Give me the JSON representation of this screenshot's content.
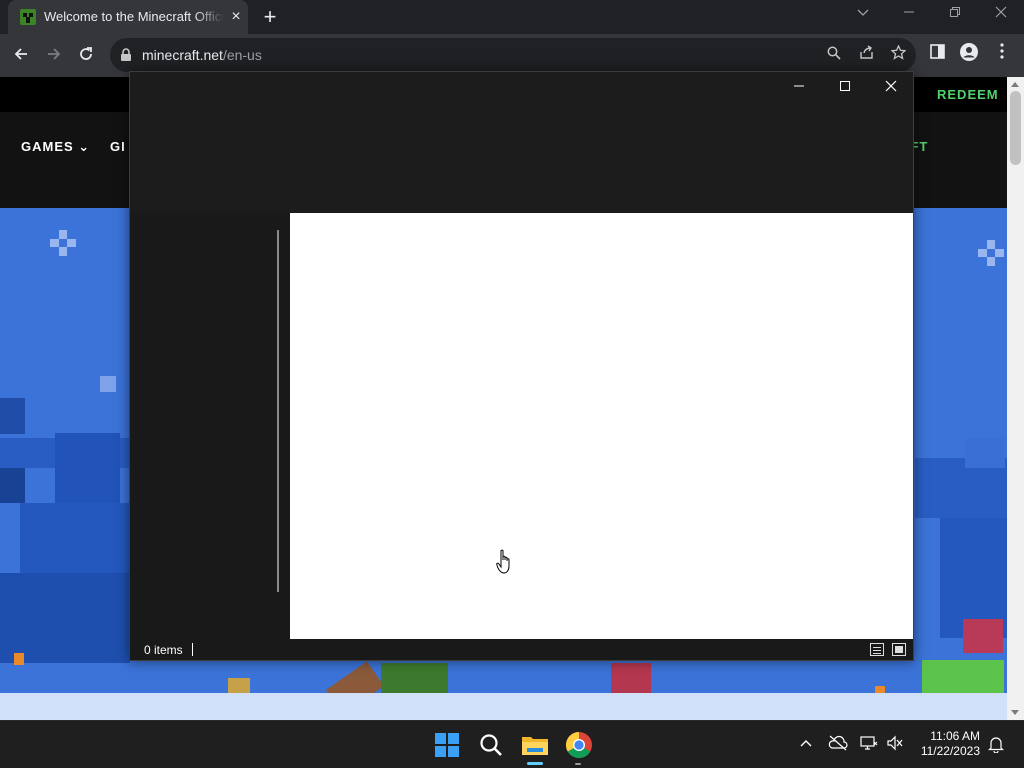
{
  "browser": {
    "tab_title": "Welcome to the Minecraft Official Site",
    "tab_close": "×",
    "new_tab": "+",
    "url_host": "minecraft.net",
    "url_path": "/en-us"
  },
  "webpage": {
    "redeem_label": "REDEEM",
    "nav_games": "GAMES",
    "nav_gift_partial": "GI",
    "nav_craft_partial": "AFT"
  },
  "explorer": {
    "status_items": "0 items"
  },
  "taskbar": {
    "time": "11:06 AM",
    "date": "11/22/2023"
  },
  "colors": {
    "accent_green": "#52d16b",
    "taskbar_active": "#60cdff"
  }
}
